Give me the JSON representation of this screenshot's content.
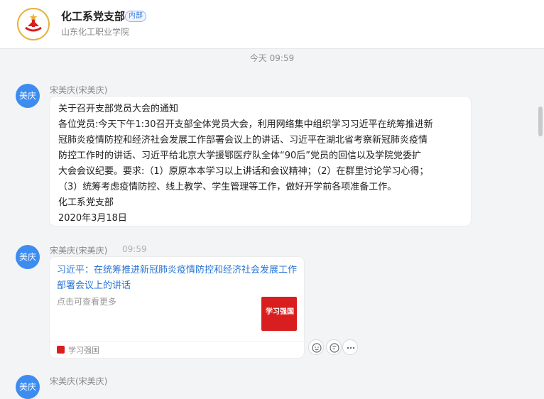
{
  "header": {
    "title": "化工系党支部",
    "badge": "内部",
    "subtitle": "山东化工职业学院",
    "logo_icon": "party-emblem-icon"
  },
  "divider": {
    "time": "今天 09:59"
  },
  "messages": [
    {
      "avatar_text": "美庆",
      "sender": "宋美庆(宋美庆)",
      "lines": [
        "关于召开支部党员大会的通知",
        "各位党员:今天下午1:30召开支部全体党员大会，利用网络集中组织学习习近平在统筹推进新",
        "冠肺炎疫情防控和经济社会发展工作部署会议上的讲话、习近平在湖北省考察新冠肺炎疫情",
        "防控工作时的讲话、习近平给北京大学援鄂医疗队全体“90后”党员的回信以及学院党委扩",
        "大会会议纪要。要求:（1）原原本本学习以上讲话和会议精神；（2）在群里讨论学习心得；",
        "（3）统筹考虑疫情防控、线上教学、学生管理等工作，做好开学前各项准备工作。",
        "化工系党支部",
        "2020年3月18日"
      ]
    },
    {
      "avatar_text": "美庆",
      "sender": "宋美庆(宋美庆)",
      "time": "09:59",
      "link_title": "习近平：在统筹推进新冠肺炎疫情防控和经济社会发展工作部署会议上的讲话",
      "link_desc": "点击可查看更多",
      "thumb_text": "学习强国",
      "source": "学习强国"
    },
    {
      "avatar_text": "美庆",
      "sender": "宋美庆(宋美庆)"
    }
  ],
  "actions": [
    "emoji-icon",
    "reply-icon",
    "more-icon"
  ],
  "colors": {
    "avatar": "#3d8cf0",
    "link": "#2a74d4",
    "brand_red": "#d81e1e"
  }
}
